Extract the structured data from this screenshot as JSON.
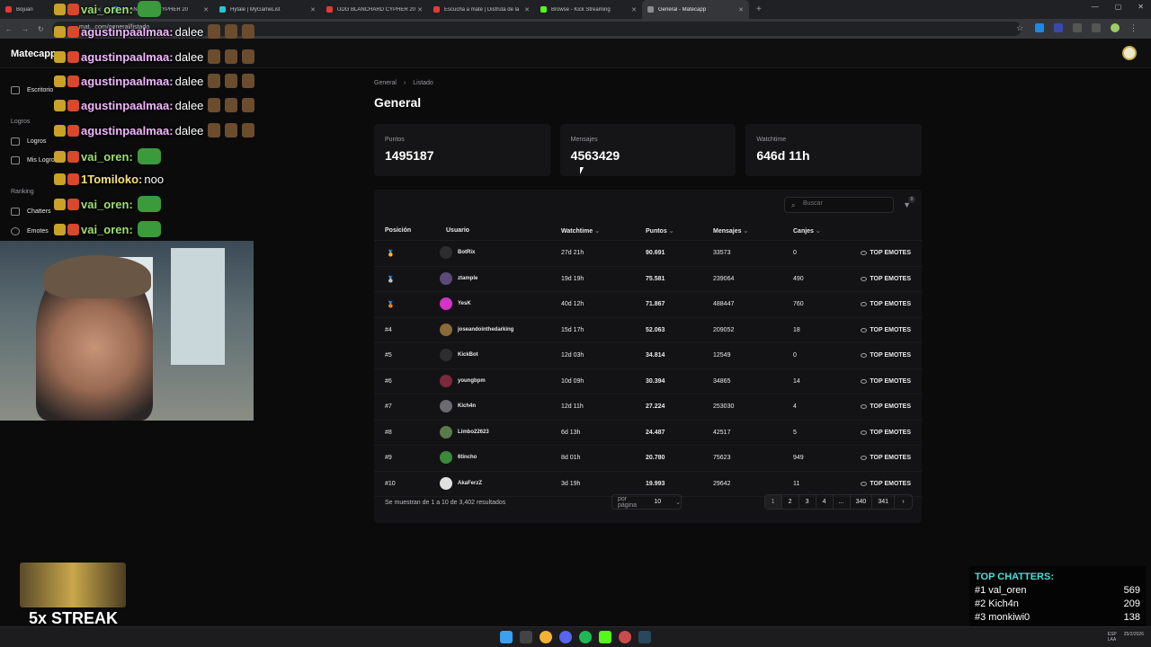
{
  "browser": {
    "tabs": [
      {
        "title": "Bojuan",
        "color": "#e53935",
        "active": false
      },
      {
        "title": "BLANCHARD CYPHER 20",
        "color": "#1e88e5",
        "active": false
      },
      {
        "title": "Hytale | MyGameList",
        "color": "#26c6da",
        "active": false
      },
      {
        "title": "UDG BLANCHARD CYPHER 20",
        "color": "#e53935",
        "active": false
      },
      {
        "title": "Escucha a mate | Disfruta de la",
        "color": "#e53935",
        "active": false
      },
      {
        "title": "Browse - Kick Streaming",
        "color": "#53fc18",
        "active": false
      },
      {
        "title": "General - Matecapp",
        "color": "#8c8c92",
        "active": true
      }
    ],
    "url": "mat...com/general/listado"
  },
  "app": {
    "brand": "Matecapp",
    "sidebar": {
      "escritorio": "Escritorio",
      "section_logros": "Logros",
      "logros": "Logros",
      "mis_logros": "Mis Logros",
      "section_ranking": "Ranking",
      "chatters": "Chatters",
      "emotes": "Emotes"
    },
    "breadcrumb": [
      "General",
      "Listado"
    ],
    "title": "General",
    "stats": [
      {
        "label": "Puntos",
        "value": "1495187"
      },
      {
        "label": "Mensajes",
        "value": "4563429"
      },
      {
        "label": "Watchtime",
        "value": "646d 11h"
      }
    ],
    "search_placeholder": "Buscar",
    "filter_count": "0",
    "columns": {
      "posicion": "Posición",
      "usuario": "Usuario",
      "watchtime": "Watchtime",
      "puntos": "Puntos",
      "mensajes": "Mensajes",
      "canjes": "Canjes"
    },
    "rows": [
      {
        "pos": "🥇",
        "user": "BotRix",
        "av": "#2d2d30",
        "watch": "27d 21h",
        "pts": "90.691",
        "msgs": "33573",
        "canjes": "0",
        "action": "TOP EMOTES"
      },
      {
        "pos": "🥈",
        "user": "ztample",
        "av": "#5b4a7a",
        "watch": "19d 19h",
        "pts": "75.581",
        "msgs": "239064",
        "canjes": "490",
        "action": "TOP EMOTES"
      },
      {
        "pos": "🥉",
        "user": "YesK",
        "av": "#d633c8",
        "watch": "40d 12h",
        "pts": "71.867",
        "msgs": "488447",
        "canjes": "760",
        "action": "TOP EMOTES"
      },
      {
        "pos": "#4",
        "user": "joseandointhedarking",
        "av": "#8a6a3a",
        "watch": "15d 17h",
        "pts": "52.063",
        "msgs": "209052",
        "canjes": "18",
        "action": "TOP EMOTES"
      },
      {
        "pos": "#5",
        "user": "KickBot",
        "av": "#2d2d30",
        "watch": "12d 03h",
        "pts": "34.814",
        "msgs": "12549",
        "canjes": "0",
        "action": "TOP EMOTES"
      },
      {
        "pos": "#6",
        "user": "youngbpm",
        "av": "#7a2a3a",
        "watch": "10d 09h",
        "pts": "30.394",
        "msgs": "34865",
        "canjes": "14",
        "action": "TOP EMOTES"
      },
      {
        "pos": "#7",
        "user": "Kich4n",
        "av": "#6a6a70",
        "watch": "12d 11h",
        "pts": "27.224",
        "msgs": "253030",
        "canjes": "4",
        "action": "TOP EMOTES"
      },
      {
        "pos": "#8",
        "user": "Limbo22623",
        "av": "#5a7a4a",
        "watch": "6d 13h",
        "pts": "24.487",
        "msgs": "42517",
        "canjes": "5",
        "action": "TOP EMOTES"
      },
      {
        "pos": "#9",
        "user": "6tincho",
        "av": "#3a8a3a",
        "watch": "8d 01h",
        "pts": "20.780",
        "msgs": "75623",
        "canjes": "949",
        "action": "TOP EMOTES"
      },
      {
        "pos": "#10",
        "user": "AkaFerzZ",
        "av": "#e0e0e0",
        "watch": "3d 19h",
        "pts": "19.993",
        "msgs": "29642",
        "canjes": "11",
        "action": "TOP EMOTES"
      }
    ],
    "footer_text": "Se muestran de 1 a 10 de 3,402 resultados",
    "per_page_label": "por página",
    "per_page_value": "10",
    "pages": [
      "1",
      "2",
      "3",
      "4",
      "...",
      "340",
      "341",
      "›"
    ]
  },
  "overlay": {
    "chat": [
      {
        "user": "vai_oren:",
        "cls": "name-g",
        "msg": "",
        "emote": "g"
      },
      {
        "user": "agustinpaalmaa:",
        "cls": "name-p",
        "msg": "dalee",
        "emote": "b"
      },
      {
        "user": "agustinpaalmaa:",
        "cls": "name-p",
        "msg": "dalee",
        "emote": "b"
      },
      {
        "user": "agustinpaalmaa:",
        "cls": "name-p",
        "msg": "dalee",
        "emote": "b"
      },
      {
        "user": "agustinpaalmaa:",
        "cls": "name-p",
        "msg": "dalee",
        "emote": "b"
      },
      {
        "user": "agustinpaalmaa:",
        "cls": "name-p",
        "msg": "dalee",
        "emote": "b"
      },
      {
        "user": "vai_oren:",
        "cls": "name-g",
        "msg": "",
        "emote": "g"
      },
      {
        "user": "1Tomiloko:",
        "cls": "name-y",
        "msg": "noo",
        "emote": ""
      },
      {
        "user": "vai_oren:",
        "cls": "name-g",
        "msg": "",
        "emote": "g"
      },
      {
        "user": "vai_oren:",
        "cls": "name-g",
        "msg": "",
        "emote": "g"
      }
    ],
    "streak": "5x STREAK",
    "top_chatters_title": "TOP CHATTERS:",
    "top_chatters": [
      {
        "rank": "#1 val_oren",
        "count": "569"
      },
      {
        "rank": "#2 Kich4n",
        "count": "209"
      },
      {
        "rank": "#3 monkiwi0",
        "count": "138"
      }
    ]
  },
  "taskbar": {
    "lang1": "ESP",
    "lang2": "LAA",
    "date": "25/2/2026"
  }
}
